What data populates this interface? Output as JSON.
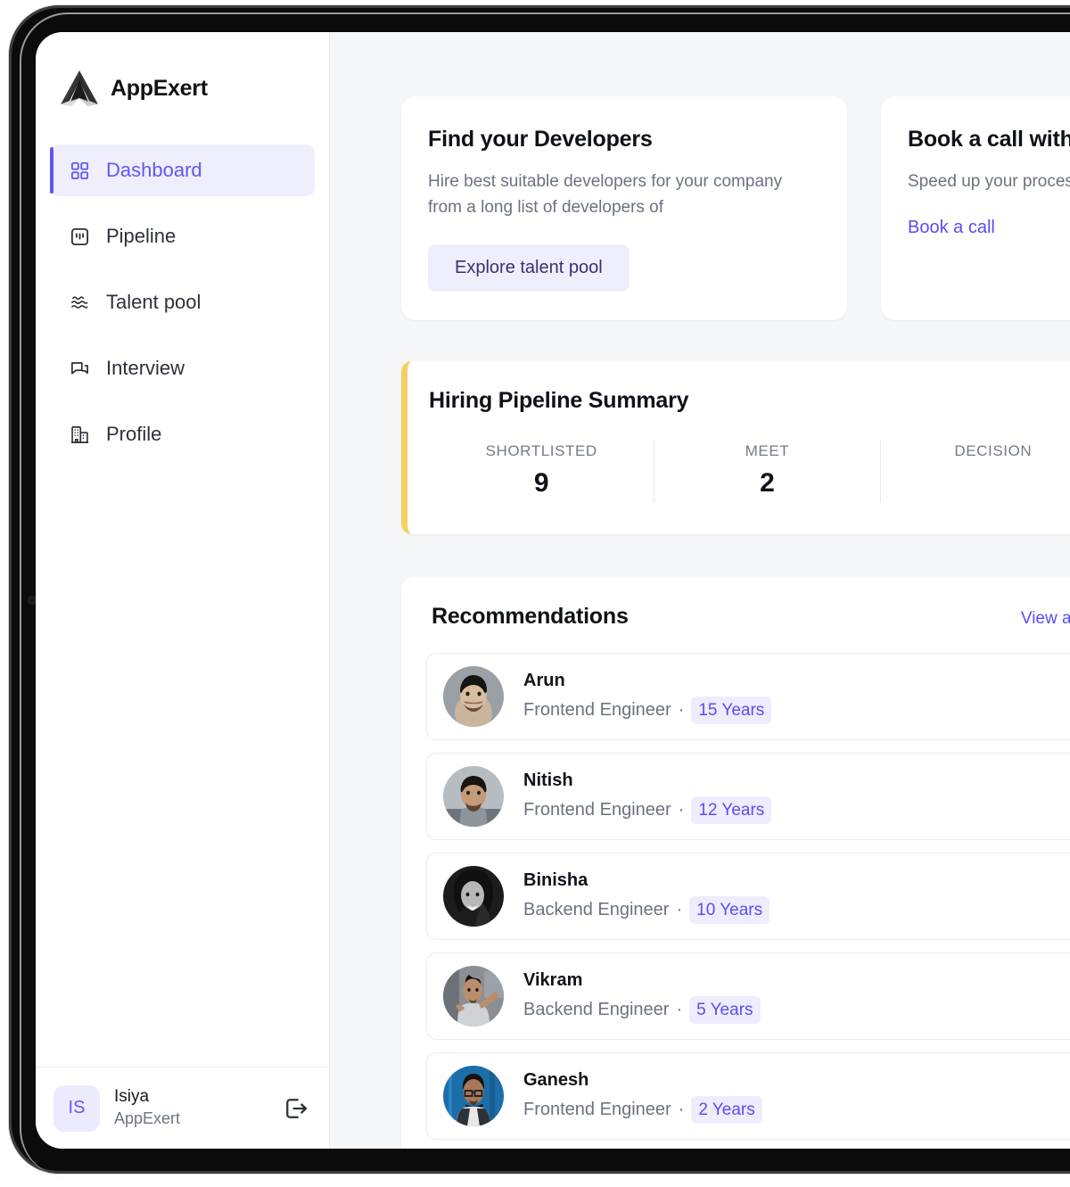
{
  "brand": {
    "name": "AppExert",
    "logo_icon": "appexert-arrow-logo"
  },
  "sidebar": {
    "items": [
      {
        "label": "Dashboard",
        "icon": "grid-icon",
        "active": true
      },
      {
        "label": "Pipeline",
        "icon": "kanban-icon",
        "active": false
      },
      {
        "label": "Talent pool",
        "icon": "waves-icon",
        "active": false
      },
      {
        "label": "Interview",
        "icon": "chat-icon",
        "active": false
      },
      {
        "label": "Profile",
        "icon": "building-icon",
        "active": false
      }
    ],
    "footer": {
      "avatar_initials": "IS",
      "user_name": "Isiya",
      "org_name": "AppExert",
      "logout_icon": "logout-icon"
    }
  },
  "main": {
    "promo_cards": [
      {
        "title": "Find your Developers",
        "description": "Hire best suitable developers for your company from a long list of developers of",
        "action_label": "Explore talent pool",
        "action_type": "button"
      },
      {
        "title": "Book a call with us",
        "description": "Speed up your process by connecting with us.",
        "action_label": "Book a call",
        "action_type": "link"
      }
    ],
    "pipeline_summary": {
      "title": "Hiring Pipeline Summary",
      "accent_color": "#F5D061",
      "stats": [
        {
          "label": "SHORTLISTED",
          "value": "9"
        },
        {
          "label": "MEET",
          "value": "2"
        },
        {
          "label": "DECISION",
          "value": ""
        }
      ]
    },
    "recommendations": {
      "title": "Recommendations",
      "view_all_label": "View all",
      "items": [
        {
          "name": "Arun",
          "role": "Frontend Engineer",
          "separator": "·",
          "experience": "15 Years",
          "avatar": "photo-arun"
        },
        {
          "name": "Nitish",
          "role": "Frontend Engineer",
          "separator": "·",
          "experience": "12 Years",
          "avatar": "photo-nitish"
        },
        {
          "name": "Binisha",
          "role": "Backend Engineer",
          "separator": "·",
          "experience": "10 Years",
          "avatar": "photo-binisha"
        },
        {
          "name": "Vikram",
          "role": "Backend Engineer",
          "separator": "·",
          "experience": "5 Years",
          "avatar": "photo-vikram"
        },
        {
          "name": "Ganesh",
          "role": "Frontend Engineer",
          "separator": "·",
          "experience": "2 Years",
          "avatar": "photo-ganesh"
        }
      ]
    }
  },
  "theme": {
    "accent_purple": "#5B4BF5",
    "accent_purple_soft": "#EFEEFC",
    "accent_yellow": "#F5D061",
    "app_background": "#F4F6F8",
    "card_background": "#FFFFFF",
    "text_primary": "#0F1218",
    "text_muted": "#6B7280"
  }
}
